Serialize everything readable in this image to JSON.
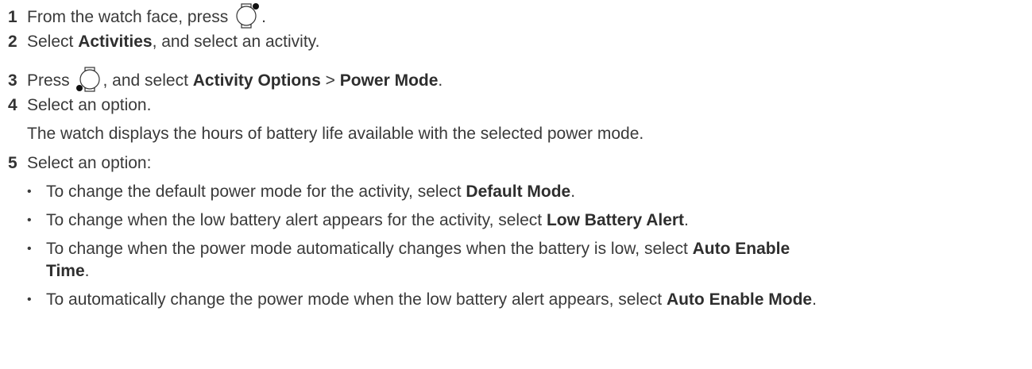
{
  "steps": [
    {
      "num": "1",
      "pre": "From the watch face, press ",
      "icon": "watch-start-button-icon",
      "post": "."
    },
    {
      "num": "2",
      "pre": "Select ",
      "b1": "Activities",
      "post": ", and select an activity."
    },
    {
      "num": "3",
      "pre": "Press ",
      "icon": "watch-menu-button-icon",
      "mid": ", and select ",
      "b1": "Activity Options",
      "sep": " > ",
      "b2": "Power Mode",
      "post": "."
    },
    {
      "num": "4",
      "text": "Select an option."
    },
    {
      "num": "5",
      "text": "Select an option:"
    }
  ],
  "step4_note": "The watch displays the hours of battery life available with the selected power mode.",
  "bullet_glyph": "•",
  "options": [
    {
      "pre": "To change the default power mode for the activity, select ",
      "bold": "Default Mode",
      "post": "."
    },
    {
      "pre": "To change when the low battery alert appears for the activity, select ",
      "bold": "Low Battery Alert",
      "post": "."
    },
    {
      "pre": "To change when the power mode automatically changes when the battery is low, select ",
      "bold": "Auto Enable",
      "bold2": "Time",
      "post": "."
    },
    {
      "pre": "To automatically change the power mode when the low battery alert appears, select ",
      "bold": "Auto Enable Mode",
      "post": "."
    }
  ]
}
